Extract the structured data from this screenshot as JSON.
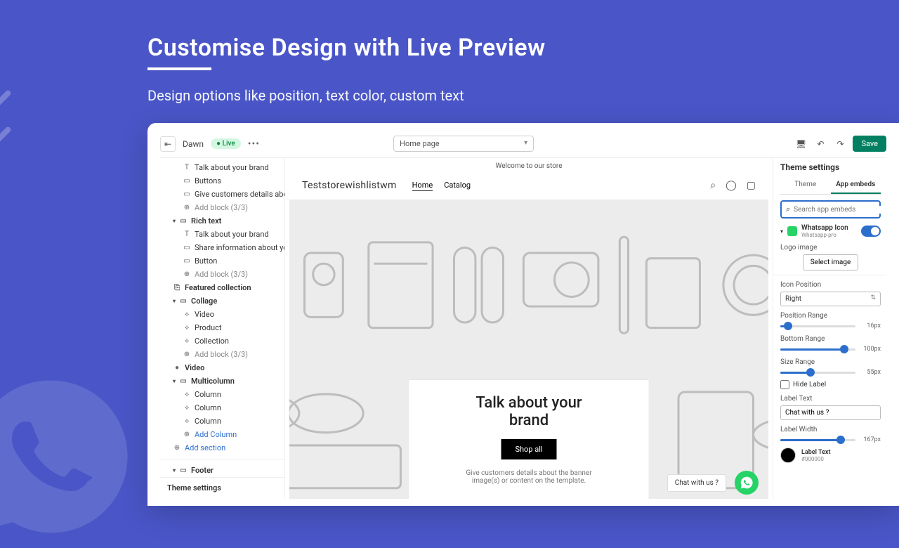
{
  "hero": {
    "title_prefix": "Custo",
    "title_rest": "mise Design with Live Preview",
    "subtitle": "Design options like position, text color, custom text"
  },
  "topbar": {
    "theme": "Dawn",
    "live_badge": "● Live",
    "page_selector": "Home page",
    "save": "Save"
  },
  "leftpanel": {
    "items": [
      {
        "icon": "T",
        "label": "Talk about your brand",
        "indent": 2
      },
      {
        "icon": "▭",
        "label": "Buttons",
        "indent": 2
      },
      {
        "icon": "▭",
        "label": "Give customers details abou...",
        "indent": 2
      },
      {
        "icon": "⊕",
        "label": "Add block (3/3)",
        "indent": 2,
        "muted": true
      },
      {
        "icon": "▾",
        "label": "Rich text",
        "indent": 1,
        "bold": true,
        "chev": true,
        "boxicon": "▭"
      },
      {
        "icon": "T",
        "label": "Talk about your brand",
        "indent": 2
      },
      {
        "icon": "▭",
        "label": "Share information about you...",
        "indent": 2
      },
      {
        "icon": "▭",
        "label": "Button",
        "indent": 2
      },
      {
        "icon": "⊕",
        "label": "Add block (3/3)",
        "indent": 2,
        "muted": true
      },
      {
        "icon": "⎘",
        "label": "Featured collection",
        "indent": 1,
        "bold": true
      },
      {
        "icon": "▾",
        "label": "Collage",
        "indent": 1,
        "bold": true,
        "chev": true,
        "boxicon": "▭"
      },
      {
        "icon": "⟡",
        "label": "Video",
        "indent": 2
      },
      {
        "icon": "⟡",
        "label": "Product",
        "indent": 2
      },
      {
        "icon": "⟡",
        "label": "Collection",
        "indent": 2
      },
      {
        "icon": "⊕",
        "label": "Add block (3/3)",
        "indent": 2,
        "muted": true
      },
      {
        "icon": "●",
        "label": "Video",
        "indent": 1,
        "bold": true
      },
      {
        "icon": "▾",
        "label": "Multicolumn",
        "indent": 1,
        "bold": true,
        "chev": true,
        "boxicon": "▭"
      },
      {
        "icon": "⟡",
        "label": "Column",
        "indent": 2
      },
      {
        "icon": "⟡",
        "label": "Column",
        "indent": 2
      },
      {
        "icon": "⟡",
        "label": "Column",
        "indent": 2
      },
      {
        "icon": "⊕",
        "label": "Add Column",
        "indent": 2,
        "blue": true
      },
      {
        "icon": "⊕",
        "label": "Add section",
        "indent": 1,
        "blue": true
      },
      {
        "sep": true
      },
      {
        "icon": "▸",
        "label": "Footer",
        "indent": 1,
        "bold": true,
        "chev": true,
        "boxicon": "▭"
      }
    ],
    "footer": "Theme settings"
  },
  "canvas": {
    "announce": "Welcome to our store",
    "logo": "Teststorewishlistwm",
    "nav": [
      "Home",
      "Catalog"
    ],
    "hero_title": "Talk about your brand",
    "hero_btn": "Shop all",
    "hero_desc": "Give customers details about the banner image(s) or content on the template.",
    "chat_label": "Chat with us ?"
  },
  "rightpanel": {
    "title": "Theme settings",
    "tabs": [
      "Theme",
      "App embeds"
    ],
    "search_placeholder": "Search app embeds",
    "embed_name": "Whatsapp Icon",
    "embed_sub": "Whatsapp-pro",
    "logo_label": "Logo image",
    "select_image": "Select image",
    "icon_position_label": "Icon Position",
    "icon_position_value": "Right",
    "position_range_label": "Position Range",
    "position_range_value": "16px",
    "bottom_range_label": "Bottom Range",
    "bottom_range_value": "100px",
    "size_range_label": "Size Range",
    "size_range_value": "55px",
    "hide_label": "Hide Label",
    "label_text_label": "Label Text",
    "label_text_value": "Chat with us ?",
    "label_width_label": "Label Width",
    "label_width_value": "167px",
    "color_label": "Label Text",
    "color_hex": "#000000"
  }
}
